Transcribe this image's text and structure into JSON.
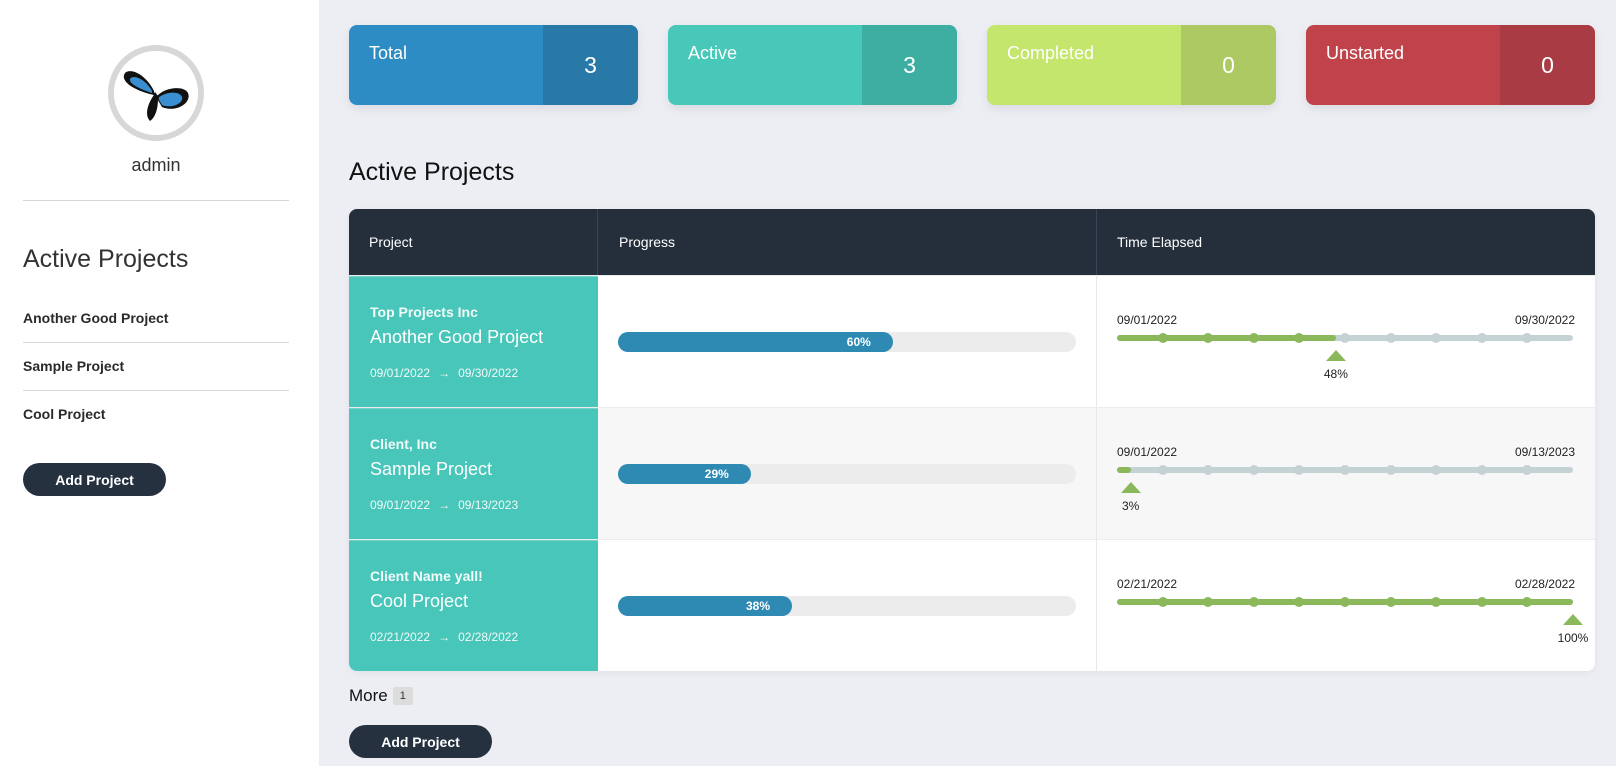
{
  "sidebar": {
    "username": "admin",
    "title": "Active Projects",
    "projects": [
      "Another Good Project",
      "Sample Project",
      "Cool Project"
    ],
    "add_label": "Add Project"
  },
  "stats": [
    {
      "label": "Total",
      "value": "3",
      "color": "#2d8cc4"
    },
    {
      "label": "Active",
      "value": "3",
      "color": "#47c8b9"
    },
    {
      "label": "Completed",
      "value": "0",
      "color": "#c4e66c"
    },
    {
      "label": "Unstarted",
      "value": "0",
      "color": "#c0434c"
    }
  ],
  "main": {
    "title": "Active Projects",
    "columns": [
      "Project",
      "Progress",
      "Time Elapsed"
    ],
    "rows": [
      {
        "client": "Top Projects Inc",
        "name": "Another Good Project",
        "start": "09/01/2022",
        "end": "09/30/2022",
        "progress_label": "60%",
        "progress": 0.6,
        "elapsed_label": "48%",
        "elapsed": 0.48
      },
      {
        "client": "Client, Inc",
        "name": "Sample Project",
        "start": "09/01/2022",
        "end": "09/13/2023",
        "progress_label": "29%",
        "progress": 0.29,
        "elapsed_label": "3%",
        "elapsed": 0.03
      },
      {
        "client": "Client Name yall!",
        "name": "Cool Project",
        "start": "02/21/2022",
        "end": "02/28/2022",
        "progress_label": "38%",
        "progress": 0.38,
        "elapsed_label": "100%",
        "elapsed": 1.0
      }
    ],
    "arrow": "→",
    "more_label": "More",
    "more_count": "1",
    "add_label": "Add Project"
  },
  "colors": {
    "accent": "#47c6b9",
    "progress": "#2e8ab3",
    "timeline": "#8ab85a",
    "dark": "#252f3b"
  }
}
